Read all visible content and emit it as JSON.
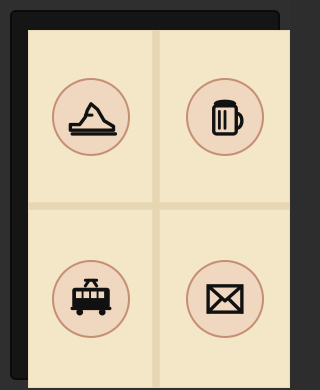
{
  "screen": {
    "tiles": [
      {
        "icon": "shoe-icon"
      },
      {
        "icon": "beer-mug-icon"
      },
      {
        "icon": "tram-icon"
      },
      {
        "icon": "envelope-icon"
      }
    ]
  }
}
